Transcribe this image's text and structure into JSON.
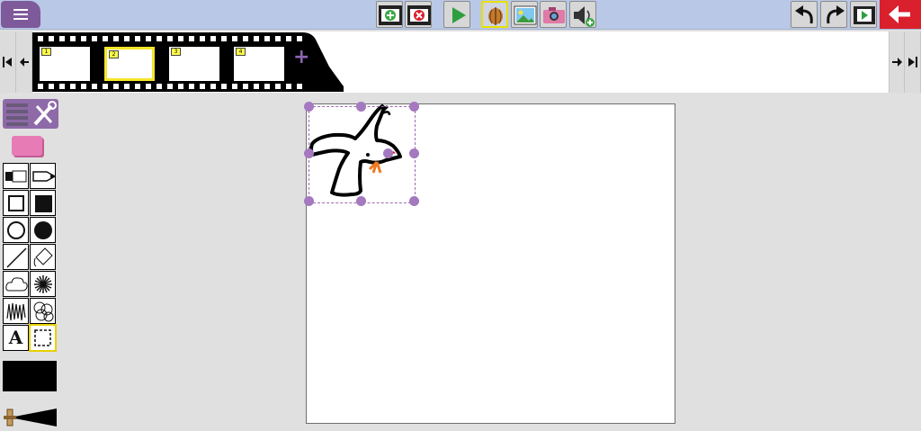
{
  "toolbar": {
    "menu_icon": "hamburger-icon",
    "buttons": [
      "add-frame",
      "delete-frame",
      "play",
      "onion-skin",
      "insert-image",
      "camera",
      "add-sound",
      "undo",
      "redo",
      "preview-movie",
      "back"
    ]
  },
  "timeline": {
    "frames": [
      {
        "number": "1",
        "selected": false
      },
      {
        "number": "2",
        "selected": true
      },
      {
        "number": "3",
        "selected": false
      },
      {
        "number": "4",
        "selected": false
      }
    ],
    "add_label": "+"
  },
  "tools": {
    "text_tool_label": "A",
    "selected": "selection-tool",
    "current_color": "#000000",
    "pen_size_icon": "brush-size-icon"
  },
  "colors": {
    "topbar": "#b9c8e6",
    "menu": "#7e5a9b",
    "back": "#d9202c",
    "highlight": "#f5e628",
    "selection": "#a479bf",
    "beak": "#f07a1e"
  }
}
